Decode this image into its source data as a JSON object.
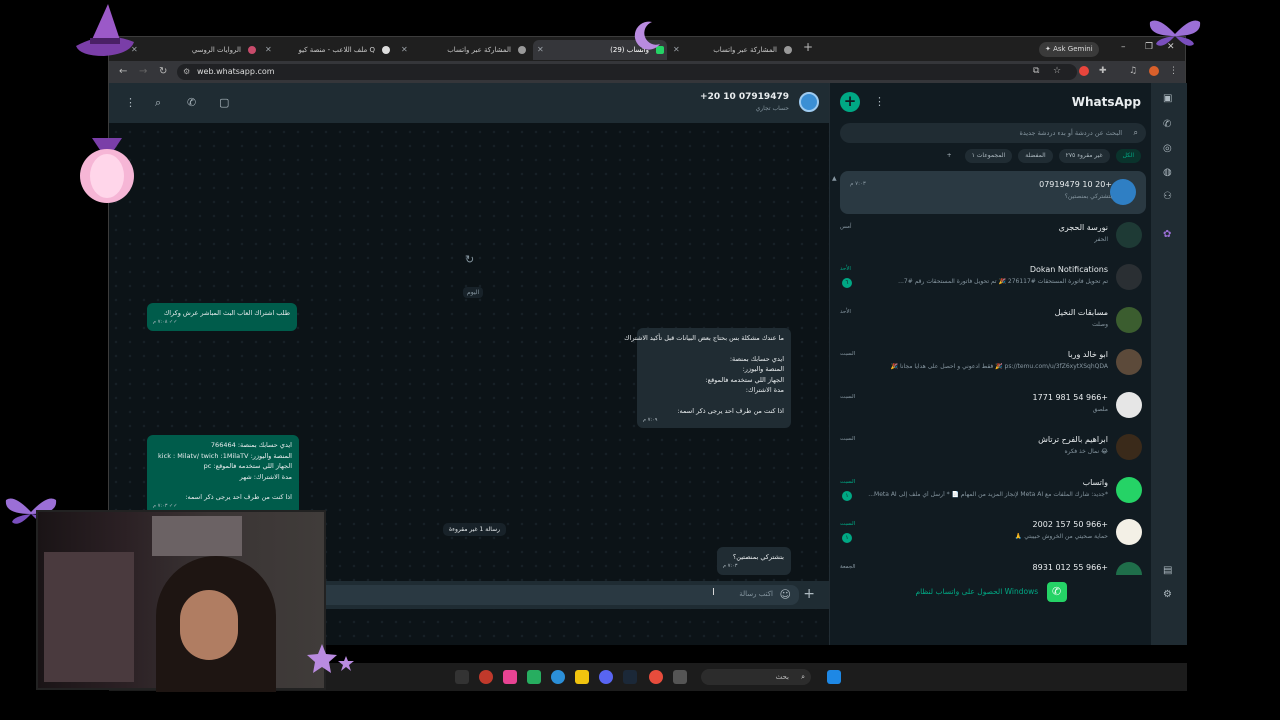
{
  "browser": {
    "tabs": [
      {
        "label": "الروايات الروسي"
      },
      {
        "label": "ملف اللاعب - منصة كيو Q"
      },
      {
        "label": "المشاركة عبر واتساب"
      },
      {
        "label": "(29) واتساب"
      },
      {
        "label": "المشاركة عبر واتساب"
      }
    ],
    "new_tab": "+",
    "ask_gemini": "Ask Gemini",
    "url": "web.whatsapp.com"
  },
  "chat": {
    "contact_name": "+20 10 07919479",
    "contact_sub": "حساب تجاري",
    "day_label": "اليوم",
    "unread_label": "رسالة 1 غير مقروءة",
    "messages": [
      {
        "lines": [
          "طلب اشتراك العاب البث المباشر عرش وكراك"
        ],
        "time": "٧:٠٨ م ✓✓"
      },
      {
        "lines": [
          "ما عندك مشكلة بس بحتاج بعض البيانات قبل تأكيد الاشتراك",
          "",
          "ايدي حسابك بمنصة:",
          "المنصة واليوزر:",
          "الجهاز اللي ستخدمه فالموقع:",
          "مدة الاشتراك:",
          "",
          "اذا كنت من طرف احد يرجى ذكر اسمه:"
        ],
        "time": "٧:٠٩ م"
      },
      {
        "lines": [
          "ايدي حسابك بمنصة: 766464",
          "المنصة واليوزر: kick : Milatv/ twich :1MilaTV",
          "الجهاز اللي ستخدمه فالموقع: pc",
          "مدة الاشتراك: شهر",
          "",
          "اذا كنت من طرف احد يرجى ذكر اسمه:"
        ],
        "time": "٧:٠٣ م ✓✓"
      },
      {
        "lines": [
          "بتشتركي بمنصتين؟"
        ],
        "time": "٧:٠٣ م"
      }
    ],
    "composer_placeholder": "اكتب رسالة"
  },
  "sidebar": {
    "title": "WhatsApp",
    "search_placeholder": "البحث عن دردشة أو بدء دردشة جديدة",
    "filters": [
      "الكل",
      "غير مقروء ٢٧٥",
      "المفضلة",
      "المجموعات ١",
      "+"
    ],
    "chats": [
      {
        "name": "+20 10 07919479",
        "preview": "بتشتركي بمنصتين؟",
        "time": "٧:٠٣ م",
        "badge": "",
        "avatar_color": "#2f7fc4"
      },
      {
        "name": "نورسة الحجري",
        "preview": "الحفر",
        "time": "أمس",
        "badge": "",
        "avatar_color": "#1e3a35"
      },
      {
        "name": "Dokan Notifications",
        "preview": "تم تحويل فاتورة المستحقات #276117 🎉 تم تحويل فاتورة المستحقات رقم #7...",
        "time": "الأحد",
        "badge": "٦",
        "avatar_color": "#2a2f33"
      },
      {
        "name": "مسابقات النخيل",
        "preview": "وصلت",
        "time": "الأحد",
        "badge": "",
        "avatar_color": "#3b5d2f"
      },
      {
        "name": "ابو خالد وربا",
        "preview": "ps://temu.com/u/3fZ6xytXSqhQDA 🎉 فقط ادعوني و احصل على هدايا مجانا 🎉",
        "time": "السبت",
        "badge": "",
        "avatar_color": "#5c4a3a"
      },
      {
        "name": "+966 54 981 1771",
        "preview": "ملصق",
        "time": "السبت",
        "badge": "",
        "avatar_color": "#e6e6e6"
      },
      {
        "name": "ابراهيم بالفرح ترتاش",
        "preview": "😂 نمال خذ فكره",
        "time": "السبت",
        "badge": "",
        "avatar_color": "#3a2a1a"
      },
      {
        "name": "واتساب",
        "preview": "*جديد: شارك الملفات مع Meta AI لإنجاز المزيد من المهام 📄 * أرسل أي ملف إلى Meta AI...",
        "time": "السبت",
        "badge": "١",
        "avatar_color": "#25d366"
      },
      {
        "name": "+966 50 157 2002",
        "preview": "حماية صحيتي من الخروش حبيبتي 🙏",
        "time": "السبت",
        "badge": "١",
        "avatar_color": "#f3f0e6"
      },
      {
        "name": "+966 55 012 8931",
        "preview": "",
        "time": "الجمعة",
        "badge": "",
        "avatar_color": "#1f6e4a"
      }
    ],
    "get_windows": "الحصول على واتساب لنظام Windows"
  },
  "taskbar": {
    "search_label": "بحث"
  }
}
